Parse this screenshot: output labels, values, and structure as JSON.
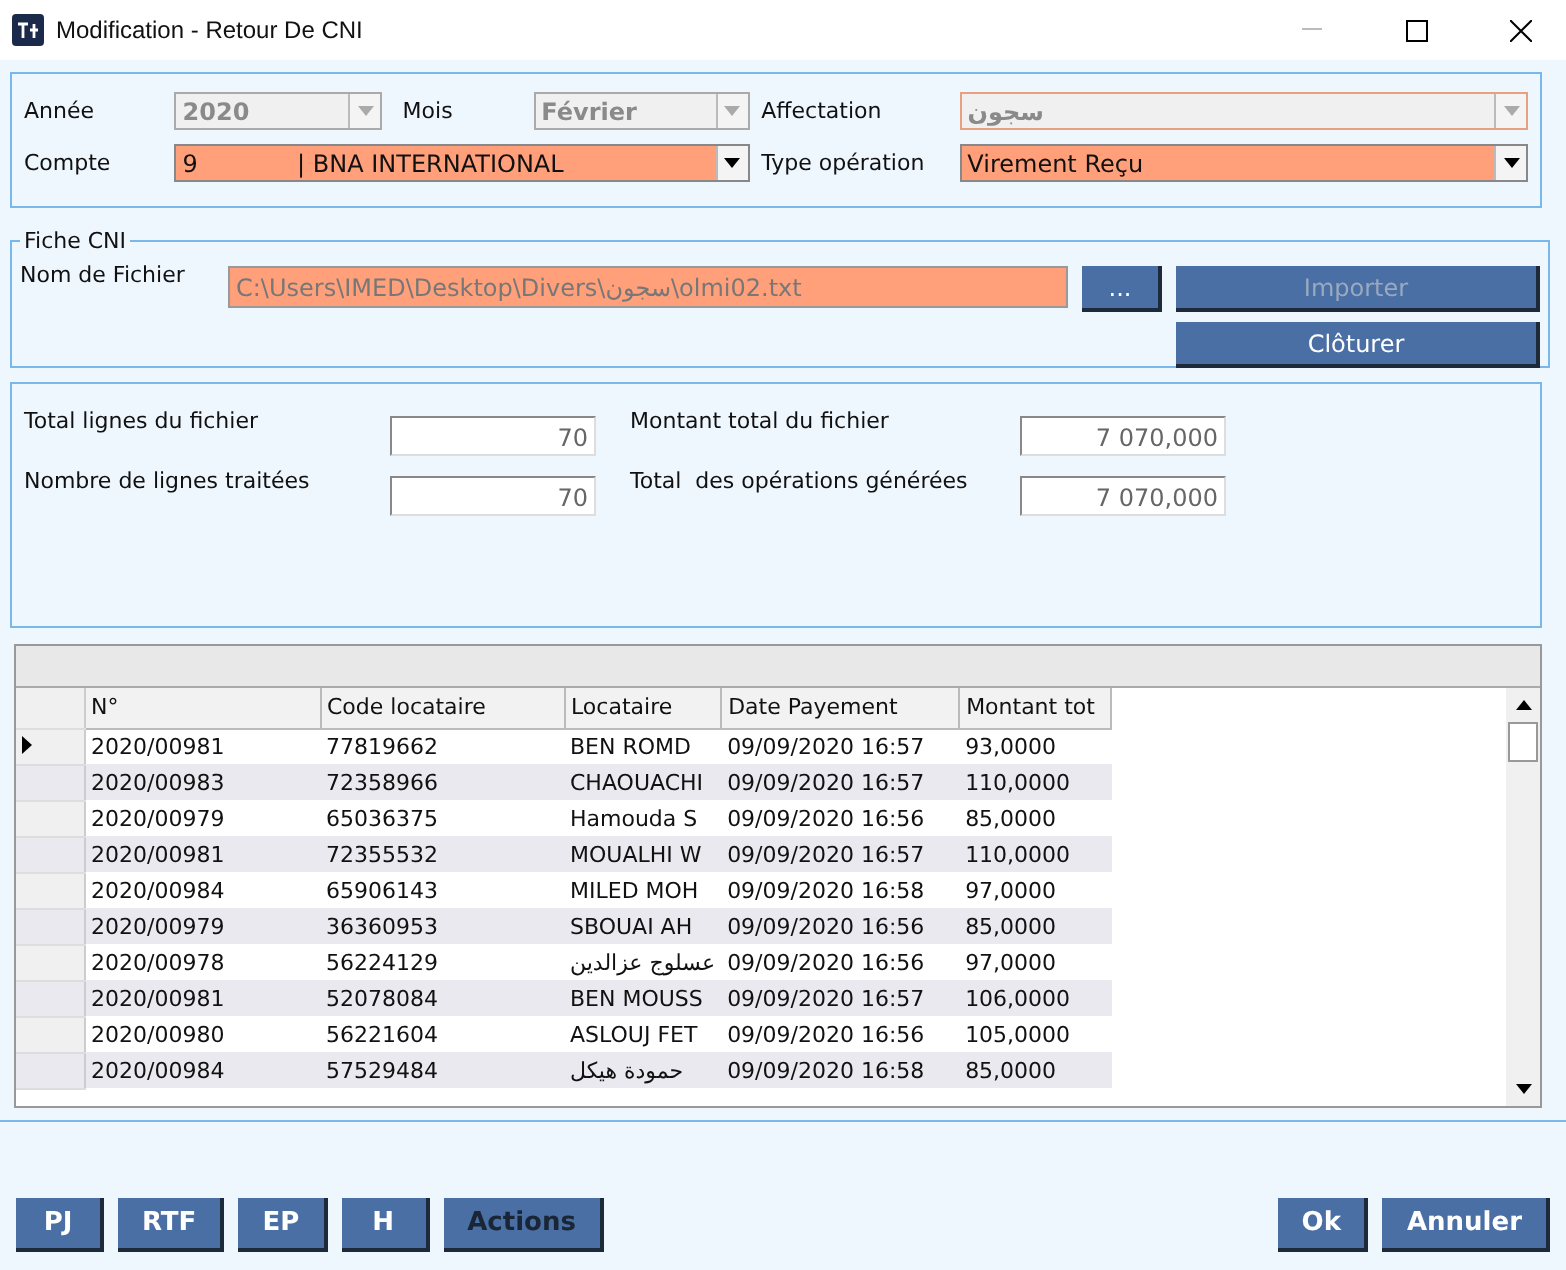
{
  "window": {
    "title": "Modification - Retour De CNI"
  },
  "header": {
    "row1": [
      {
        "label": "Année",
        "value": "2020",
        "disabled": true,
        "highlight": false
      },
      {
        "label": "Mois",
        "value": "Février",
        "disabled": true,
        "highlight": false
      },
      {
        "label": "Affectation",
        "value": "سجون",
        "disabled": true,
        "highlight": true
      }
    ],
    "row2": [
      {
        "label": "Compte",
        "value": "9             | BNA INTERNATIONAL",
        "disabled": false,
        "highlight": true
      },
      {
        "label": "Type opération",
        "value": "Virement Reçu",
        "disabled": false,
        "highlight": true
      }
    ]
  },
  "fiche": {
    "legend": "Fiche CNI",
    "file_label": "Nom de Fichier",
    "file_value": "C:\\Users\\IMED\\Desktop\\Divers\\سجون\\olmi02.txt",
    "browse": "...",
    "buttons": [
      {
        "label": "Importer",
        "disabled": true
      },
      {
        "label": "Clôturer",
        "disabled": false
      }
    ]
  },
  "totals": [
    {
      "label": "Total lignes du fichier",
      "value": "70"
    },
    {
      "label": "Montant total du fichier",
      "value": "7 070,000"
    },
    {
      "label": "Nombre de lignes traitées",
      "value": "70"
    },
    {
      "label": "Total  des opérations générées",
      "value": "7 070,000"
    }
  ],
  "table": {
    "columns": [
      "N°",
      "Code locataire",
      "Locataire",
      "Date Payement",
      "Montant tot"
    ],
    "rows": [
      {
        "cells": [
          "2020/00981",
          "77819662",
          "BEN ROMD",
          "09/09/2020 16:57",
          "93,0000"
        ],
        "selected": true
      },
      {
        "cells": [
          "2020/00983",
          "72358966",
          "CHAOUACHI",
          "09/09/2020 16:57",
          "110,0000"
        ],
        "selected": false
      },
      {
        "cells": [
          "2020/00979",
          "65036375",
          "Hamouda S",
          "09/09/2020 16:56",
          "85,0000"
        ],
        "selected": false
      },
      {
        "cells": [
          "2020/00981",
          "72355532",
          "MOUALHI W",
          "09/09/2020 16:57",
          "110,0000"
        ],
        "selected": false
      },
      {
        "cells": [
          "2020/00984",
          "65906143",
          "MILED MOH",
          "09/09/2020 16:58",
          "97,0000"
        ],
        "selected": false
      },
      {
        "cells": [
          "2020/00979",
          "36360953",
          "SBOUAI AH",
          "09/09/2020 16:56",
          "85,0000"
        ],
        "selected": false
      },
      {
        "cells": [
          "2020/00978",
          "56224129",
          "عسلوج عزالدين",
          "09/09/2020 16:56",
          "97,0000"
        ],
        "selected": false
      },
      {
        "cells": [
          "2020/00981",
          "52078084",
          "BEN MOUSS",
          "09/09/2020 16:57",
          "106,0000"
        ],
        "selected": false
      },
      {
        "cells": [
          "2020/00980",
          "56221604",
          "ASLOUJ FET",
          "09/09/2020 16:56",
          "105,0000"
        ],
        "selected": false
      },
      {
        "cells": [
          "2020/00984",
          "57529484",
          "حمودة هيكل",
          "09/09/2020 16:58",
          "85,0000"
        ],
        "selected": false
      }
    ]
  },
  "footer": {
    "left": [
      {
        "label": "PJ",
        "disabled": false
      },
      {
        "label": "RTF",
        "disabled": false
      },
      {
        "label": "EP",
        "disabled": false
      },
      {
        "label": "H",
        "disabled": false
      },
      {
        "label": "Actions",
        "disabled": true
      }
    ],
    "right": [
      {
        "label": "Ok",
        "disabled": false
      },
      {
        "label": "Annuler",
        "disabled": false
      }
    ]
  }
}
